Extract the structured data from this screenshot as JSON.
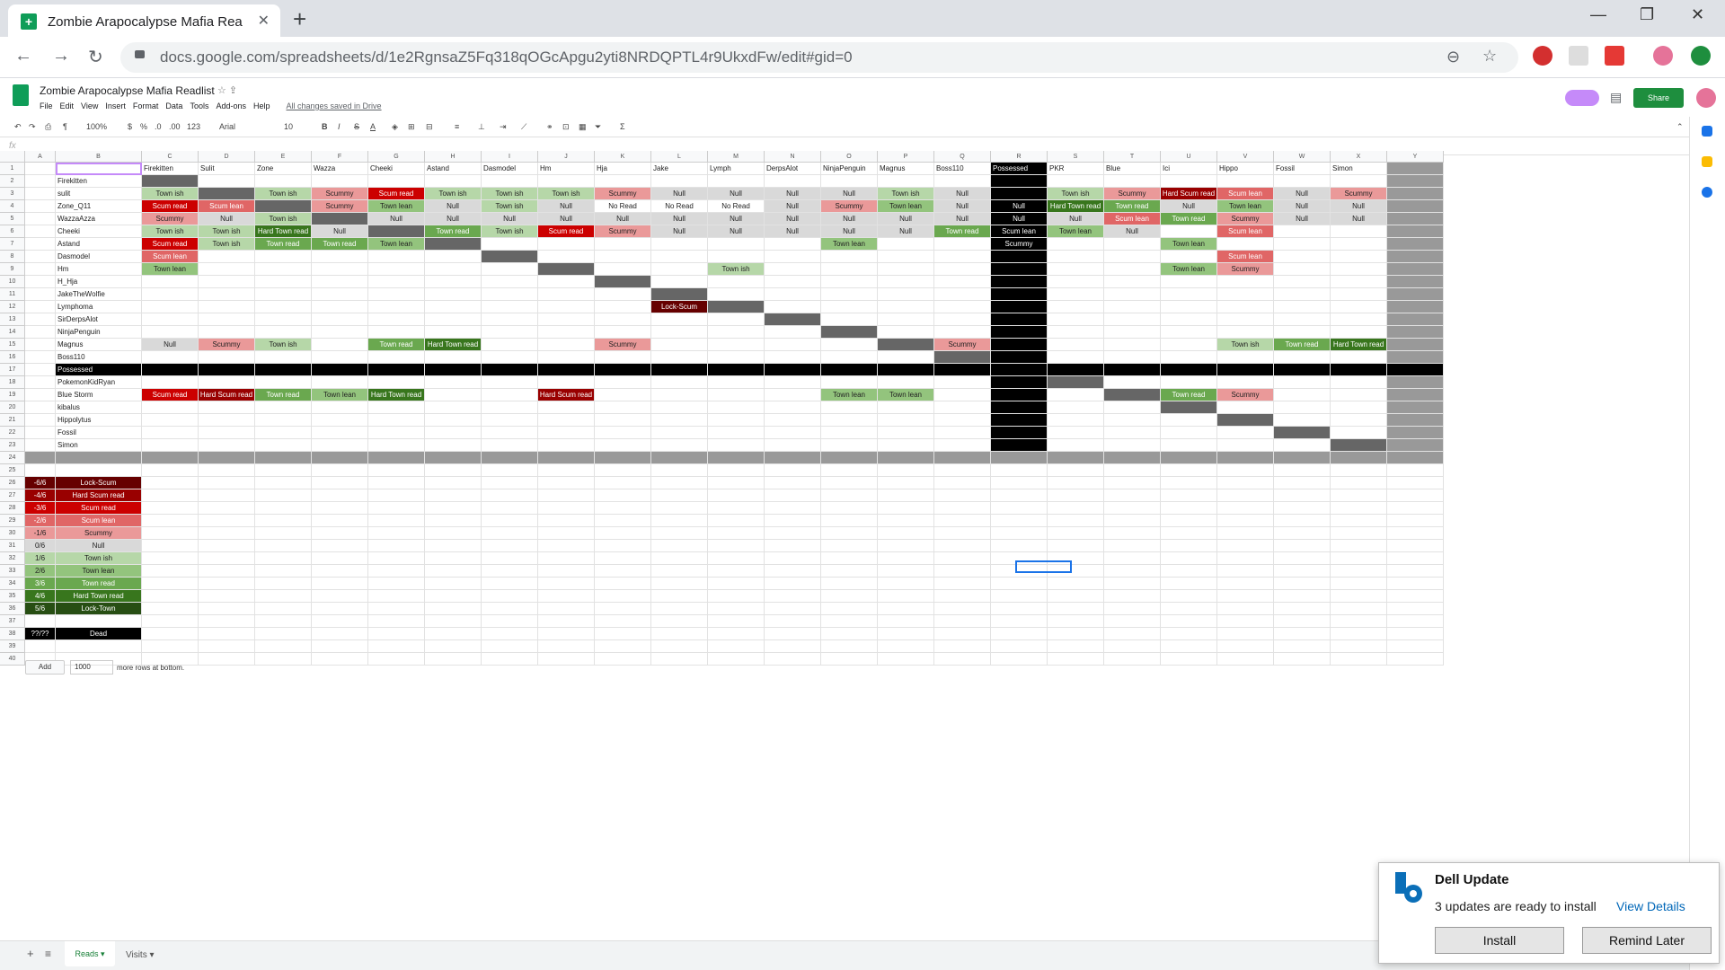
{
  "browser": {
    "tab_title": "Zombie Arapocalypse Mafia Rea",
    "url_host": "docs.google.com",
    "url_path": "/spreadsheets/d/1e2RgnsaZ5Fq318qOGcApgu2yti8NRDQPTL4r9UkxdFw/edit#gid=0"
  },
  "doc": {
    "title": "Zombie Arapocalypse Mafia Readlist",
    "menus": [
      "File",
      "Edit",
      "View",
      "Insert",
      "Format",
      "Data",
      "Tools",
      "Add-ons",
      "Help"
    ],
    "saved": "All changes saved in Drive",
    "share": "Share",
    "toolbar": {
      "zoom": "100%",
      "currency": "$",
      "percent": "%",
      "dec_less": ".0",
      "dec_more": ".00",
      "format": "123",
      "font": "Arial",
      "size": "10"
    },
    "fx": "fx"
  },
  "colors": {
    "Town": "#93c47d",
    "Town ish": "#b6d7a8",
    "Town lean": "#93c47d",
    "Town read": "#6aa84f",
    "Hard Town read": "#38761d",
    "Lock-Town": "#274e13",
    "Null": "#d9d9d9",
    "Scummy": "#ea9999",
    "Scum lean": "#e06666",
    "Scum read": "#cc0000",
    "Hard Scum read": "#990000",
    "Lock-Scum": "#660000",
    "No Read": "#ffffff",
    "Dead": "#000000"
  },
  "sheet": {
    "col_letters": [
      "A",
      "B",
      "C",
      "D",
      "E",
      "F",
      "G",
      "H",
      "I",
      "J",
      "K",
      "L",
      "M",
      "N",
      "O",
      "P",
      "Q",
      "R",
      "S",
      "T",
      "U",
      "V",
      "W",
      "X",
      "Y"
    ],
    "header_row": [
      "Firekitten",
      "Sulit",
      "Zone",
      "Wazza",
      "Cheeki",
      "Astand",
      "Dasmodel",
      "Hm",
      "Hja",
      "Jake",
      "Lymph",
      "DerpsAlot",
      "NinjaPenguin",
      "Magnus",
      "Boss110",
      "Possessed",
      "PKR",
      "Blue",
      "Ici",
      "Hippo",
      "Fossil",
      "Simon"
    ],
    "players": [
      "Firekitten",
      "sulit",
      "Zone_Q11",
      "WazzaAzza",
      "Cheeki",
      "Astand",
      "Dasmodel",
      "Hm",
      "H_Hja",
      "JakeTheWolfie",
      "Lymphoma",
      "SirDerpsAlot",
      "NinjaPenguin",
      "Magnus",
      "Boss110",
      "Possessed",
      "PokemonKidRyan",
      "Blue Storm",
      "kibalus",
      "Hippolytus",
      "Fossil",
      "Simon"
    ],
    "reads": [
      [],
      [
        "Town ish",
        null,
        "Town ish",
        "Scummy",
        "Scum read",
        "Town ish",
        "Town ish",
        "Town ish",
        "Scummy",
        "Null",
        "Null",
        "Null",
        "Null",
        "Town ish",
        "Null",
        null,
        "Town ish",
        "Scummy",
        "Hard Scum read",
        "Scum lean",
        "Null",
        "Scummy"
      ],
      [
        "Scum read",
        "Scum lean",
        null,
        "Scummy",
        "Town lean",
        "Null",
        "Town ish",
        "Null",
        "No Read",
        "No Read",
        "No Read",
        "Null",
        "Scummy",
        "Town lean",
        "Null",
        "Null",
        "Hard Town read",
        "Town read",
        "Null",
        "Town lean",
        "Null",
        "Null"
      ],
      [
        "Scummy",
        "Null",
        "Town ish",
        null,
        "Null",
        "Null",
        "Null",
        "Null",
        "Null",
        "Null",
        "Null",
        "Null",
        "Null",
        "Null",
        "Null",
        "Null",
        "Null",
        "Scum lean",
        "Town read",
        "Scummy",
        "Null",
        "Null"
      ],
      [
        "Town ish",
        "Town ish",
        "Hard Town read",
        "Null",
        null,
        "Town read",
        "Town ish",
        "Scum read",
        "Scummy",
        "Null",
        "Null",
        "Null",
        "Null",
        "Null",
        "Town read",
        "Scum lean",
        "Town lean",
        "Null",
        "",
        "Scum lean",
        "",
        ""
      ],
      [
        "Scum read",
        "Town ish",
        "Town read",
        "Town read",
        "Town lean",
        null,
        "",
        "",
        "",
        "",
        "",
        "",
        "Town lean",
        "",
        "",
        "Scummy",
        "",
        "",
        "Town lean",
        "",
        "",
        ""
      ],
      [
        "Scum lean",
        "",
        "",
        "",
        "",
        "",
        null,
        "",
        "",
        "",
        "",
        "",
        "",
        "",
        "",
        "",
        "",
        "",
        "",
        "Scum lean",
        "",
        ""
      ],
      [
        "Town lean",
        "",
        "",
        "",
        "",
        "",
        "",
        null,
        "",
        "",
        "Town ish",
        "",
        "",
        "",
        "",
        "",
        "",
        "",
        "Town lean",
        "Scummy",
        "",
        ""
      ],
      [],
      [],
      [
        "",
        "",
        "",
        "",
        "",
        "",
        "",
        "",
        "",
        "Lock-Scum"
      ],
      [],
      [],
      [
        "Null",
        "Scummy",
        "Town ish",
        "",
        "Town read",
        "Hard Town read",
        "",
        "",
        "Scummy",
        "",
        "",
        "",
        "",
        "Town read",
        "Scummy",
        "",
        "",
        "",
        "",
        "Town ish",
        "Town read",
        "Hard Town read"
      ],
      [],
      [],
      [],
      [
        "Scum read",
        "Hard Scum read",
        "Town read",
        "Town lean",
        "Hard Town read",
        "",
        "",
        "Hard Scum read",
        "",
        "",
        "",
        "",
        "Town lean",
        "Town lean",
        "",
        "",
        "",
        "",
        "Town read",
        "Scummy",
        "",
        ""
      ],
      [],
      [],
      [],
      [],
      []
    ],
    "legend": [
      {
        "value": "-6/6",
        "label": "Lock-Scum"
      },
      {
        "value": "-4/6",
        "label": "Hard Scum read"
      },
      {
        "value": "-3/6",
        "label": "Scum read"
      },
      {
        "value": "-2/6",
        "label": "Scum lean"
      },
      {
        "value": "-1/6",
        "label": "Scummy"
      },
      {
        "value": "0/6",
        "label": "Null"
      },
      {
        "value": "1/6",
        "label": "Town ish"
      },
      {
        "value": "2/6",
        "label": "Town lean"
      },
      {
        "value": "3/6",
        "label": "Town read"
      },
      {
        "value": "4/6",
        "label": "Hard Town read"
      },
      {
        "value": "5/6",
        "label": "Lock-Town"
      }
    ],
    "dead_legend": {
      "value": "??/??",
      "label": "Dead"
    },
    "add_rows": {
      "button": "Add",
      "count": "1000",
      "text": "more rows at bottom."
    }
  },
  "sheet_tabs": {
    "active": "Reads",
    "other": "Visits"
  },
  "toast": {
    "title": "Dell Update",
    "body": "3 updates are ready to install",
    "link": "View Details",
    "install": "Install",
    "later": "Remind Later"
  }
}
